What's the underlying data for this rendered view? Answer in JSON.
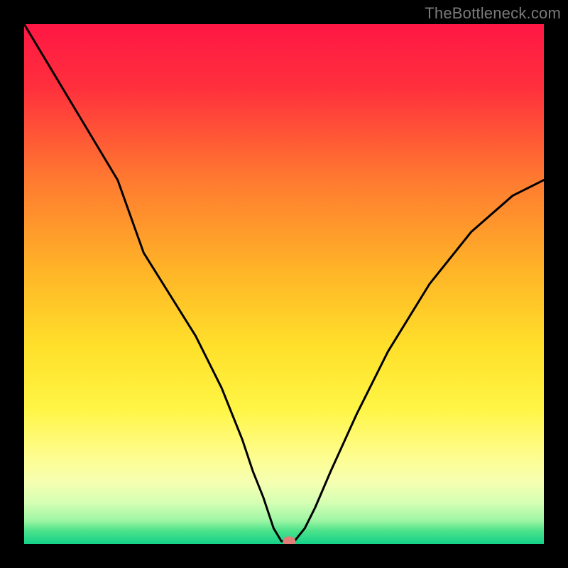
{
  "watermark": "TheBottleneck.com",
  "chart_data": {
    "type": "line",
    "title": "",
    "xlabel": "",
    "ylabel": "",
    "xlim": [
      0,
      100
    ],
    "ylim": [
      0,
      100
    ],
    "x": [
      0,
      6,
      12,
      18,
      23,
      28,
      33,
      38,
      42,
      44,
      46,
      48,
      49.5,
      52,
      54,
      56,
      59,
      64,
      70,
      78,
      86,
      94,
      100
    ],
    "values": [
      100,
      90,
      80,
      70,
      56,
      48,
      40,
      30,
      20,
      14,
      9,
      3,
      0.5,
      0.5,
      3,
      7,
      14,
      25,
      37,
      50,
      60,
      67,
      70
    ],
    "marker": {
      "x": 51,
      "y": 0.5,
      "color": "#e07f78"
    },
    "background_gradient": {
      "stops": [
        {
          "offset": 0.0,
          "color": "#ff1744"
        },
        {
          "offset": 0.12,
          "color": "#ff2f3d"
        },
        {
          "offset": 0.3,
          "color": "#ff7a30"
        },
        {
          "offset": 0.48,
          "color": "#ffb627"
        },
        {
          "offset": 0.62,
          "color": "#ffe02a"
        },
        {
          "offset": 0.74,
          "color": "#fff545"
        },
        {
          "offset": 0.82,
          "color": "#fffc86"
        },
        {
          "offset": 0.88,
          "color": "#f6ffb0"
        },
        {
          "offset": 0.92,
          "color": "#d6ffb4"
        },
        {
          "offset": 0.955,
          "color": "#9ef6a4"
        },
        {
          "offset": 0.975,
          "color": "#4be28a"
        },
        {
          "offset": 1.0,
          "color": "#14d28a"
        }
      ]
    },
    "line_color": "#000000",
    "line_width": 3
  }
}
